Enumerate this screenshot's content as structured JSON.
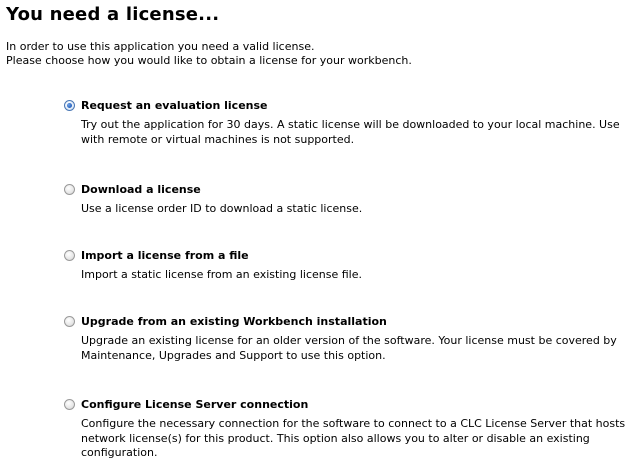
{
  "heading": "You need a license...",
  "intro": {
    "line1": "In order to use this application you need a valid license.",
    "line2": "Please choose how you would like to obtain a license for your workbench."
  },
  "options": [
    {
      "label": "Request an evaluation license",
      "checked": true,
      "description": "Try out the application for 30 days. A static license will be downloaded to your local machine. Use with remote or virtual machines is not supported."
    },
    {
      "label": "Download a license",
      "checked": false,
      "description": "Use a license order ID to download a static license."
    },
    {
      "label": "Import a license from a file",
      "checked": false,
      "description": "Import a static license from an existing license file."
    },
    {
      "label": "Upgrade from an existing Workbench installation",
      "checked": false,
      "description": "Upgrade an existing license for an older version of the software. Your license must be covered by Maintenance, Upgrades and Support to use this option."
    },
    {
      "label": "Configure License Server connection",
      "checked": false,
      "description": "Configure the necessary connection for the software to connect to a CLC License Server that hosts network license(s) for this product. This option also allows you to alter or disable an existing configuration."
    }
  ],
  "colors": {
    "radio_selected": "#1b56b5",
    "radio_border": "#9a9a9a",
    "text": "#000000",
    "background": "#ffffff"
  }
}
